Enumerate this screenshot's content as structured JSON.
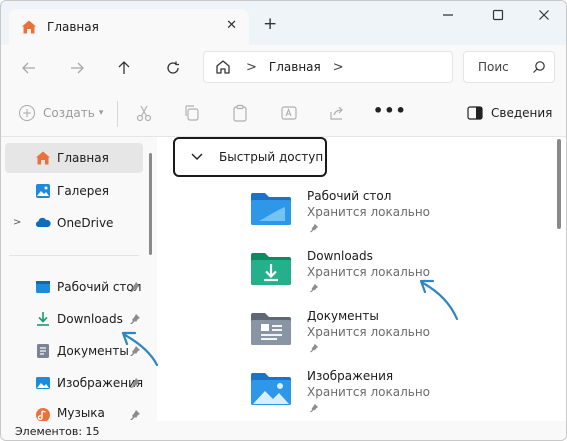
{
  "window": {
    "tab_title": "Главная",
    "new_tab": "+",
    "close_tab": "✕"
  },
  "nav": {
    "breadcrumb": [
      "Главная"
    ],
    "search_placeholder": "Поис"
  },
  "toolbar": {
    "create_label": "Создать",
    "more_label": "•••",
    "details_label": "Сведения"
  },
  "sidebar": {
    "items": [
      {
        "label": "Главная",
        "icon": "home-icon",
        "active": true
      },
      {
        "label": "Галерея",
        "icon": "gallery-icon"
      },
      {
        "label": "OneDrive",
        "icon": "onedrive-icon",
        "expandable": true
      },
      {
        "label": "Рабочий стол",
        "icon": "desktop-icon",
        "pinned": true
      },
      {
        "label": "Downloads",
        "icon": "downloads-icon",
        "pinned": true
      },
      {
        "label": "Документы",
        "icon": "documents-icon",
        "pinned": true
      },
      {
        "label": "Изображения",
        "icon": "pictures-icon",
        "pinned": true
      },
      {
        "label": "Музыка",
        "icon": "music-icon",
        "pinned": true
      }
    ]
  },
  "content": {
    "group_title": "Быстрый доступ",
    "items": [
      {
        "name": "Рабочий стол",
        "sub": "Хранится локально",
        "icon": "desktop-folder-icon"
      },
      {
        "name": "Downloads",
        "sub": "Хранится локально",
        "icon": "downloads-folder-icon"
      },
      {
        "name": "Документы",
        "sub": "Хранится локально",
        "icon": "documents-folder-icon"
      },
      {
        "name": "Изображения",
        "sub": "Хранится локально",
        "icon": "pictures-folder-icon"
      }
    ]
  },
  "status": {
    "item_count": "Элементов: 15"
  },
  "colors": {
    "accent": "#1f8bd8",
    "annotation_arrow": "#2e86c1",
    "folder_yellow": "#f2b516"
  }
}
